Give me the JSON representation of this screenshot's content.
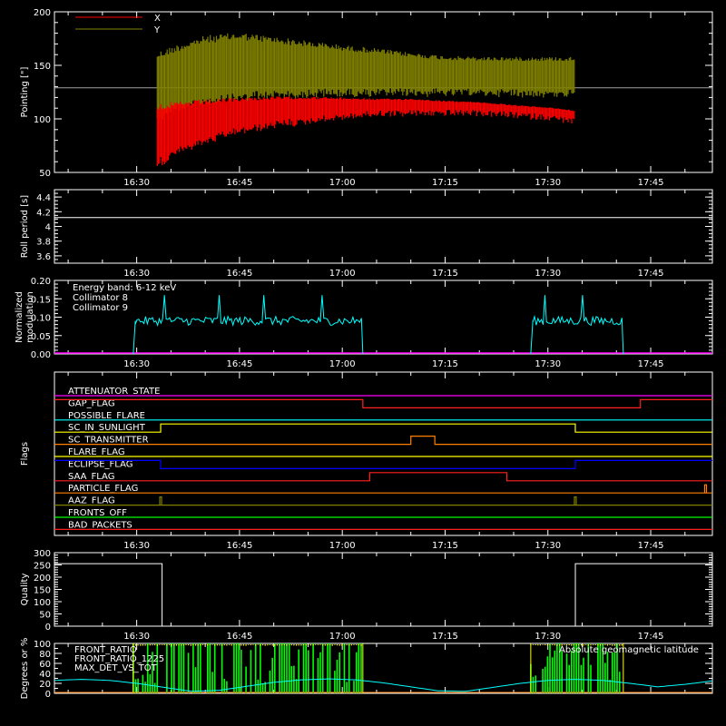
{
  "figure": {
    "background": "#000000",
    "axis_color": "#ffffff",
    "time_ticks": [
      "16:30",
      "16:45",
      "17:00",
      "17:15",
      "17:30",
      "17:45"
    ],
    "time_tick_minutes": [
      30,
      45,
      60,
      75,
      90,
      105
    ],
    "x_range_minutes": [
      18,
      114
    ]
  },
  "chart_data": [
    {
      "type": "line",
      "name": "pointing",
      "ylabel": "Pointing [\"]",
      "ylim": [
        50,
        200
      ],
      "yticks": [
        50,
        100,
        150,
        200
      ],
      "legend": [
        {
          "label": "X",
          "color": "#ff0000"
        },
        {
          "label": "Y",
          "color": "#808000"
        }
      ],
      "reference_line": {
        "value": 129,
        "color": "#a0a0a0"
      },
      "data_window_minutes": [
        33,
        94
      ],
      "series": [
        {
          "name": "Y",
          "color": "#808000",
          "x": [
            33,
            36,
            40,
            45,
            50,
            55,
            60,
            65,
            70,
            75,
            80,
            85,
            90,
            94
          ],
          "upper": [
            163,
            170,
            178,
            181,
            177,
            173,
            169,
            166,
            162,
            159,
            158,
            158,
            158,
            158
          ],
          "lower": [
            100,
            110,
            116,
            120,
            123,
            124,
            125,
            125,
            126,
            126,
            126,
            126,
            125,
            125
          ]
        },
        {
          "name": "X",
          "color": "#ff0000",
          "x": [
            33,
            36,
            40,
            45,
            50,
            55,
            60,
            65,
            70,
            75,
            80,
            85,
            90,
            94
          ],
          "upper": [
            115,
            116,
            118,
            120,
            121,
            121,
            120,
            119,
            119,
            117,
            116,
            113,
            111,
            108
          ],
          "lower": [
            58,
            70,
            80,
            90,
            96,
            100,
            104,
            107,
            108,
            108,
            108,
            106,
            104,
            100
          ]
        }
      ]
    },
    {
      "type": "line",
      "name": "roll-period",
      "ylabel": "Roll period [s]",
      "ylim": [
        3.5,
        4.5
      ],
      "yticks": [
        3.6,
        3.8,
        4.0,
        4.2,
        4.4
      ],
      "series": [
        {
          "name": "roll",
          "color": "#ffffff",
          "x": [
            18,
            114
          ],
          "values": [
            4.12,
            4.12
          ]
        }
      ]
    },
    {
      "type": "line",
      "name": "modulation",
      "ylabel": [
        "Normalized",
        "modulation"
      ],
      "ylim": [
        0,
        0.2
      ],
      "yticks": [
        0.0,
        0.05,
        0.1,
        0.15,
        0.2
      ],
      "ytick_labels": [
        "0.00",
        "0.05",
        "0.10",
        "0.15",
        "0.20"
      ],
      "legend": [
        {
          "label": "Energy band: 6-12 keV",
          "color": "#ffffff"
        },
        {
          "label": "Collimator 8",
          "color": "#00ffff"
        },
        {
          "label": "Collimator 9",
          "color": "#ff00ff"
        }
      ],
      "series": [
        {
          "name": "Collimator 8",
          "color": "#00ffff",
          "segments": [
            {
              "start": 29.5,
              "end": 63,
              "level": 0.09,
              "noise": 0.012,
              "spikes": [
                34,
                42,
                48.5,
                57
              ]
            },
            {
              "start": 87.5,
              "end": 101,
              "level": 0.09,
              "noise": 0.012,
              "spikes": [
                89.5,
                95
              ]
            }
          ]
        },
        {
          "name": "Collimator 9",
          "color": "#ff00ff",
          "x": [
            18,
            114
          ],
          "values": [
            0,
            0
          ]
        }
      ]
    },
    {
      "type": "line",
      "name": "flags",
      "ylabel": "Flags",
      "flags": [
        {
          "label": "ATTENUATOR_STATE",
          "color": "#ff00ff",
          "low": [],
          "spikes": []
        },
        {
          "label": "GAP_FLAG",
          "color": "#ff2020",
          "high": [
            [
              18,
              63
            ],
            [
              103.5,
              114
            ]
          ],
          "spikes": []
        },
        {
          "label": "POSSIBLE_FLARE",
          "color": "#00ffff",
          "high": [],
          "spikes": []
        },
        {
          "label": "SC_IN_SUNLIGHT",
          "color": "#ffff00",
          "high": [
            [
              33.5,
              94
            ]
          ],
          "spikes": []
        },
        {
          "label": "SC_TRANSMITTER",
          "color": "#ff8000",
          "high": [
            [
              70,
              73.5
            ]
          ],
          "spikes": []
        },
        {
          "label": "FLARE_FLAG",
          "color": "#ffff00",
          "high": [],
          "spikes": []
        },
        {
          "label": "ECLIPSE_FLAG",
          "color": "#0000ff",
          "high": [
            [
              18,
              33.5
            ],
            [
              94,
              114
            ]
          ],
          "spikes": []
        },
        {
          "label": "SAA_FLAG",
          "color": "#ff2020",
          "high": [
            [
              64,
              84
            ]
          ],
          "spikes": []
        },
        {
          "label": "PARTICLE_FLAG",
          "color": "#ff8000",
          "high": [],
          "spikes": [
            113
          ]
        },
        {
          "label": "AAZ_FLAG",
          "color": "#808000",
          "high": [],
          "spikes": [
            33.5,
            94
          ]
        },
        {
          "label": "FRONTS_OFF",
          "color": "#00ff00",
          "high": [],
          "spikes": []
        },
        {
          "label": "BAD_PACKETS",
          "color": "#ff2020",
          "high": [],
          "spikes": []
        }
      ]
    },
    {
      "type": "line",
      "name": "quality",
      "ylabel": "Quality",
      "ylim": [
        0,
        300
      ],
      "yticks": [
        0,
        50,
        100,
        150,
        200,
        250,
        300
      ],
      "series": [
        {
          "name": "Quality",
          "color": "#ffffff",
          "x": [
            18,
            33.7,
            33.7,
            94,
            94,
            114
          ],
          "values": [
            255,
            255,
            0,
            0,
            255,
            255
          ]
        }
      ]
    },
    {
      "type": "line",
      "name": "geomagnetic",
      "ylabel": "Degrees or %",
      "ylim": [
        0,
        100
      ],
      "yticks": [
        0,
        20,
        40,
        60,
        80,
        100
      ],
      "legend": [
        {
          "label": "FRONT_RATIO",
          "color": "#ffff00"
        },
        {
          "label": "FRONT_RATIO_1225",
          "color": "#00ff00"
        },
        {
          "label": "MAX_DET_VS_TOT",
          "color": "#ff8000"
        }
      ],
      "annotation": {
        "label": "Absolute geomagnetic latitude",
        "color": "#00ffff"
      },
      "segments": [
        [
          29.5,
          63
        ],
        [
          87.5,
          101
        ]
      ],
      "latitude": {
        "x": [
          18,
          22,
          26,
          30,
          34,
          38,
          42,
          46,
          50,
          54,
          58,
          62,
          66,
          70,
          74,
          78,
          82,
          86,
          90,
          94,
          98,
          102,
          106,
          110,
          114
        ],
        "values": [
          26,
          28,
          26,
          20,
          12,
          4,
          6,
          14,
          22,
          27,
          29,
          27,
          21,
          13,
          5,
          4,
          12,
          20,
          26,
          28,
          26,
          20,
          13,
          18,
          25
        ]
      }
    }
  ]
}
